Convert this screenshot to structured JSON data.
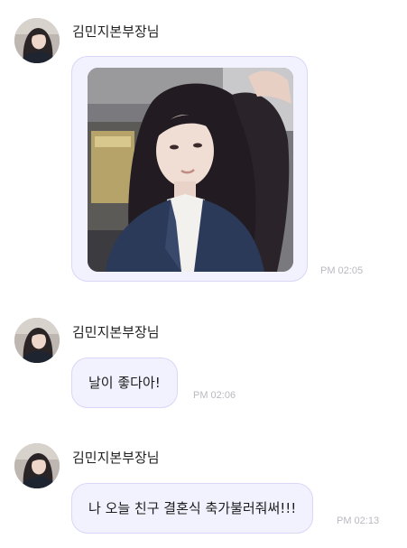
{
  "messages": [
    {
      "sender": "김민지본부장님",
      "type": "image",
      "image_alt": "selfie-photo",
      "time": "PM 02:05"
    },
    {
      "sender": "김민지본부장님",
      "type": "text",
      "text": "날이 좋다아!",
      "time": "PM 02:06"
    },
    {
      "sender": "김민지본부장님",
      "type": "text",
      "text": "나 오늘 친구 결혼식 축가불러줘써!!!",
      "time": "PM 02:13"
    }
  ],
  "colors": {
    "bubble_bg": "#f2f1fe",
    "bubble_border": "#d9d6f7",
    "time_text": "#b9b9c2"
  }
}
